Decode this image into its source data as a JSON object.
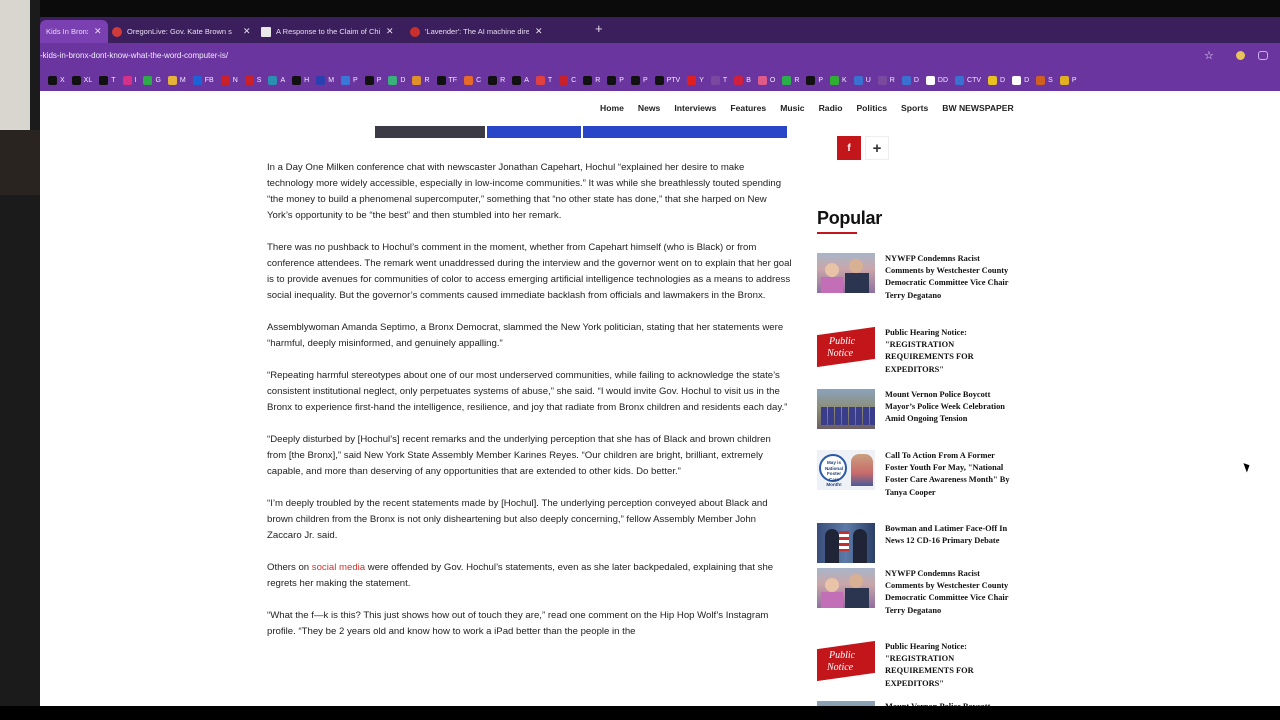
{
  "browser": {
    "tabs": [
      {
        "title": "Kids In Bronx",
        "icon": "page-icon",
        "color": "#7a3fb0",
        "active": true
      },
      {
        "title": "OregonLive: Gov. Kate Brown s",
        "icon": "oregonlive-icon",
        "color": "#d23a3a",
        "active": false
      },
      {
        "title": "A Response to the Claim of Chi",
        "icon": "doc-icon",
        "color": "#e9e9e9",
        "active": false
      },
      {
        "title": "'Lavender': The AI machine dire",
        "icon": "red-circle-icon",
        "color": "#c9302c",
        "active": false
      }
    ],
    "new_tab": "+",
    "url": "-kids-in-bronx-dont-know-what-the-word-computer-is/",
    "star": "☆",
    "bookmarks": [
      {
        "label": "X",
        "color": "#111111"
      },
      {
        "label": "XL",
        "color": "#111111"
      },
      {
        "label": "T",
        "color": "#111111"
      },
      {
        "label": "I",
        "color": "#d3318a"
      },
      {
        "label": "G",
        "color": "#2eaa4a"
      },
      {
        "label": "M",
        "color": "#e6b33a"
      },
      {
        "label": "FB",
        "color": "#1d63d8"
      },
      {
        "label": "N",
        "color": "#c9202a"
      },
      {
        "label": "S",
        "color": "#c9202a"
      },
      {
        "label": "A",
        "color": "#2a8fb0"
      },
      {
        "label": "H",
        "color": "#111111"
      },
      {
        "label": "M",
        "color": "#2a3fb0"
      },
      {
        "label": "P",
        "color": "#3a78d8"
      },
      {
        "label": "P",
        "color": "#111111"
      },
      {
        "label": "D",
        "color": "#3ab07a"
      },
      {
        "label": "R",
        "color": "#e0902a"
      },
      {
        "label": "TF",
        "color": "#111111"
      },
      {
        "label": "C",
        "color": "#e86a2a"
      },
      {
        "label": "R",
        "color": "#111111"
      },
      {
        "label": "A",
        "color": "#111111"
      },
      {
        "label": "T",
        "color": "#e04040"
      },
      {
        "label": "C",
        "color": "#c9202a"
      },
      {
        "label": "R",
        "color": "#111111"
      },
      {
        "label": "P",
        "color": "#111111"
      },
      {
        "label": "P",
        "color": "#111111"
      },
      {
        "label": "PTV",
        "color": "#111111"
      },
      {
        "label": "Y",
        "color": "#e02020"
      },
      {
        "label": "T",
        "color": "#7a4aa0"
      },
      {
        "label": "B",
        "color": "#d02040"
      },
      {
        "label": "O",
        "color": "#e05a8a"
      },
      {
        "label": "R",
        "color": "#2ab04a"
      },
      {
        "label": "P",
        "color": "#111111"
      },
      {
        "label": "K",
        "color": "#30b030"
      },
      {
        "label": "U",
        "color": "#3a70d0"
      },
      {
        "label": "R",
        "color": "#7a4aa0"
      },
      {
        "label": "D",
        "color": "#3a70d0"
      },
      {
        "label": "DD",
        "color": "#ffffff"
      },
      {
        "label": "CTV",
        "color": "#3a70d0"
      },
      {
        "label": "D",
        "color": "#e8c020"
      },
      {
        "label": "D",
        "color": "#ffffff"
      },
      {
        "label": "S",
        "color": "#d06020"
      },
      {
        "label": "P",
        "color": "#e0b020"
      }
    ]
  },
  "site": {
    "nav": [
      "Home",
      "News",
      "Interviews",
      "Features",
      "Music",
      "Radio",
      "Politics",
      "Sports",
      "BW NEWSPAPER"
    ],
    "share": {
      "facebook": "f",
      "more": "+"
    }
  },
  "article": {
    "p1": "In a Day One Milken conference chat with newscaster Jonathan Capehart, Hochul “explained her desire to make technology more widely accessible, especially in low-income communities.”  It was while she breathlessly touted spending “the money to build a phenomenal supercomputer,” something that “no other state has done,” that she harped on New York’s opportunity to be “the best” and then stumbled into her remark.",
    "p2": "There was no pushback to Hochul’s comment in the moment, whether from Capehart himself (who is Black) or from conference attendees. The remark went unaddressed during the interview and the governor went on to explain that her goal is to provide avenues for communities of color to access emerging artificial intelligence technologies as a means to address social inequality. But the governor’s comments caused immediate backlash from officials and lawmakers in the Bronx.",
    "p3": "Assemblywoman Amanda Septimo, a Bronx Democrat, slammed the New York politician, stating that her statements were “harmful, deeply misinformed, and genuinely appalling.”",
    "p4": "“Repeating harmful stereotypes about one of our most underserved communities, while failing to acknowledge the state’s consistent institutional neglect, only perpetuates systems of abuse,” she said. “I would invite Gov. Hochul to visit us in the Bronx to experience first-hand the intelligence, resilience, and joy that radiate from Bronx children and residents each day.”",
    "p5": "“Deeply disturbed by [Hochul’s] recent remarks and the underlying perception that she has of Black and brown children from [the Bronx],” said New York State Assembly Member Karines Reyes. “Our children are bright, brilliant, extremely capable, and more than deserving of any opportunities that are extended to other kids. Do better.”",
    "p6": "“I’m deeply troubled by the recent statements made by [Hochul]. The underlying perception conveyed about Black and brown children from the Bronx is not only disheartening but also deeply concerning,” fellow Assembly Member John Zaccaro Jr. said.",
    "p7_before": "Others on ",
    "p7_link": "social media",
    "p7_after": " were offended by Gov. Hochul’s statements, even as she later backpedaled, explaining that she regrets her making the statement.",
    "p8": "“What the f—k is this? This just shows how out of touch they are,” read one comment on the Hip Hop Wolf’s Instagram profile. “They be 2 years old and know how to work a iPad better than the people in the"
  },
  "sidebar": {
    "popular_heading": "Popular",
    "thumb_notice_line1": "Public",
    "thumb_notice_line2": "Notice",
    "thumb_foster_text": "May is National Foster Care Month!",
    "items": [
      {
        "title": "NYWFP Condemns Racist Comments by Westchester County Democratic Committee Vice Chair Terry Degatano",
        "thumb": "people"
      },
      {
        "title": "Public Hearing Notice: \"REGISTRATION REQUIREMENTS FOR EXPEDITORS\"",
        "thumb": "notice"
      },
      {
        "title": "Mount Vernon Police Boycott Mayor’s Police Week Celebration Amid Ongoing Tension",
        "thumb": "crowd"
      },
      {
        "title": "Call To Action From A Former Foster Youth For May, \"National Foster Care Awareness Month\" By Tanya Cooper",
        "thumb": "foster"
      },
      {
        "title": "Bowman and Latimer Face-Off In News 12 CD-16 Primary Debate",
        "thumb": "debate"
      },
      {
        "title": "NYWFP Condemns Racist Comments by Westchester County Democratic Committee Vice Chair Terry Degatano",
        "thumb": "people"
      },
      {
        "title": "Public Hearing Notice: \"REGISTRATION REQUIREMENTS FOR EXPEDITORS\"",
        "thumb": "notice"
      },
      {
        "title": "Mount Vernon Police Boycott Mayor’s Police Week Celebration Amid Ongoing Tension",
        "thumb": "crowd"
      }
    ]
  }
}
